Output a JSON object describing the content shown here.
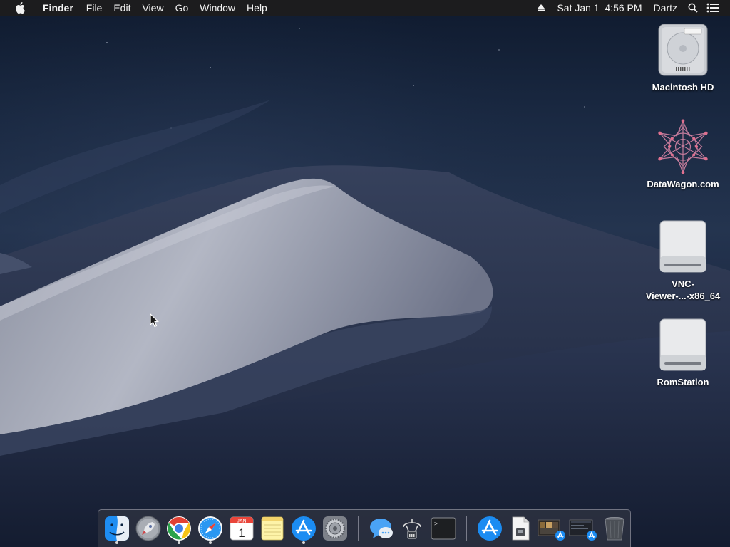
{
  "menubar": {
    "app_name": "Finder",
    "menus": [
      "File",
      "Edit",
      "View",
      "Go",
      "Window",
      "Help"
    ],
    "clock": "Sat Jan 1  4:56 PM",
    "user": "Dartz",
    "icons": [
      "apple-icon",
      "eject-icon",
      "spotlight-search-icon",
      "notification-center-icon"
    ]
  },
  "desktop_icons": [
    {
      "label": "Macintosh HD",
      "icon": "hard-drive-icon"
    },
    {
      "label": "DataWagon.com",
      "icon": "network-star-icon"
    },
    {
      "label_line1": "VNC-",
      "label_line2": "Viewer-...-x86_64",
      "icon": "disk-image-icon"
    },
    {
      "label": "RomStation",
      "icon": "disk-image-icon"
    }
  ],
  "dock": {
    "apps": [
      {
        "name": "Finder",
        "icon": "finder-icon",
        "running": true
      },
      {
        "name": "Launchpad",
        "icon": "launchpad-rocket-icon",
        "running": false
      },
      {
        "name": "Google Chrome",
        "icon": "chrome-icon",
        "running": true
      },
      {
        "name": "Safari",
        "icon": "safari-compass-icon",
        "running": true
      },
      {
        "name": "Calendar",
        "icon": "calendar-icon",
        "running": false,
        "month": "JAN",
        "day": "1"
      },
      {
        "name": "Notes",
        "icon": "notes-icon",
        "running": false
      },
      {
        "name": "App Store",
        "icon": "app-store-icon",
        "running": true
      },
      {
        "name": "System Preferences",
        "icon": "gear-icon",
        "running": false
      },
      {
        "name": "Messages",
        "icon": "messages-icon",
        "running": false
      },
      {
        "name": "Network Radar",
        "icon": "network-radar-icon",
        "running": false
      },
      {
        "name": "Terminal",
        "icon": "terminal-icon",
        "running": false,
        "prompt": ">_"
      }
    ],
    "others": [
      {
        "name": "App Store folder",
        "icon": "app-store-icon"
      },
      {
        "name": "Document",
        "icon": "document-icon"
      },
      {
        "name": "Screenshot stack 1",
        "icon": "screenshot-stack-icon"
      },
      {
        "name": "Screenshot stack 2",
        "icon": "screenshot-stack-icon"
      },
      {
        "name": "Trash",
        "icon": "trash-icon"
      }
    ]
  },
  "colors": {
    "menubar_bg": "#1c1c1e",
    "sky": "#1a2942",
    "dune_light": "#a9adbb",
    "dune_shadow": "#26324c",
    "accent_blue": "#1b8cf2"
  }
}
